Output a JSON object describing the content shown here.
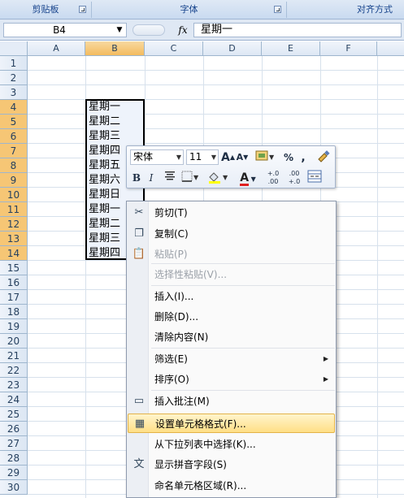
{
  "ribbon": {
    "groups": [
      {
        "label": "剪贴板"
      },
      {
        "label": "字体"
      },
      {
        "label": "对齐方式"
      }
    ]
  },
  "formula_bar": {
    "name_box": "B4",
    "fx_label": "fx",
    "content": "星期一"
  },
  "sheet": {
    "columns": [
      "A",
      "B",
      "C",
      "D",
      "E",
      "F"
    ],
    "rows": [
      "1",
      "2",
      "3",
      "4",
      "5",
      "6",
      "7",
      "8",
      "9",
      "10",
      "11",
      "12",
      "13",
      "14",
      "15",
      "16",
      "17",
      "18",
      "19",
      "20",
      "21",
      "22",
      "23",
      "24",
      "25",
      "26",
      "27",
      "28",
      "29",
      "30"
    ],
    "cells_b": [
      "星期一",
      "星期二",
      "星期三",
      "星期四",
      "星期五",
      "星期六",
      "星期日",
      "星期一",
      "星期二",
      "星期三",
      "星期四"
    ]
  },
  "mini_toolbar": {
    "font": "宋体",
    "size": "11",
    "grow_font": "A",
    "shrink_font": "A",
    "percent": "%",
    "comma": ",",
    "bold": "B",
    "italic": "I",
    "font_color": "A",
    "inc_decimal": "+.0 .00",
    "dec_decimal": ".00 +.0"
  },
  "context_menu": {
    "items": [
      {
        "label": "剪切(T)",
        "icon": "scissors-icon",
        "glyph": "✂"
      },
      {
        "label": "复制(C)",
        "icon": "copy-icon",
        "glyph": "❐"
      },
      {
        "label": "粘贴(P)",
        "icon": "paste-icon",
        "glyph": "📋"
      },
      {
        "label": "选择性粘贴(V)..."
      },
      {
        "label": "插入(I)..."
      },
      {
        "label": "删除(D)..."
      },
      {
        "label": "清除内容(N)"
      },
      {
        "label": "筛选(E)"
      },
      {
        "label": "排序(O)"
      },
      {
        "label": "插入批注(M)",
        "icon": "comment-icon",
        "glyph": "▭"
      },
      {
        "label": "设置单元格格式(F)...",
        "icon": "format-cells-icon",
        "glyph": "▦"
      },
      {
        "label": "从下拉列表中选择(K)..."
      },
      {
        "label": "显示拼音字段(S)",
        "icon": "phonetic-icon",
        "glyph": "文"
      },
      {
        "label": "命名单元格区域(R)..."
      }
    ]
  },
  "colors": {
    "selection_header": "#f6c675",
    "menu_highlight": "#ffdf86"
  }
}
